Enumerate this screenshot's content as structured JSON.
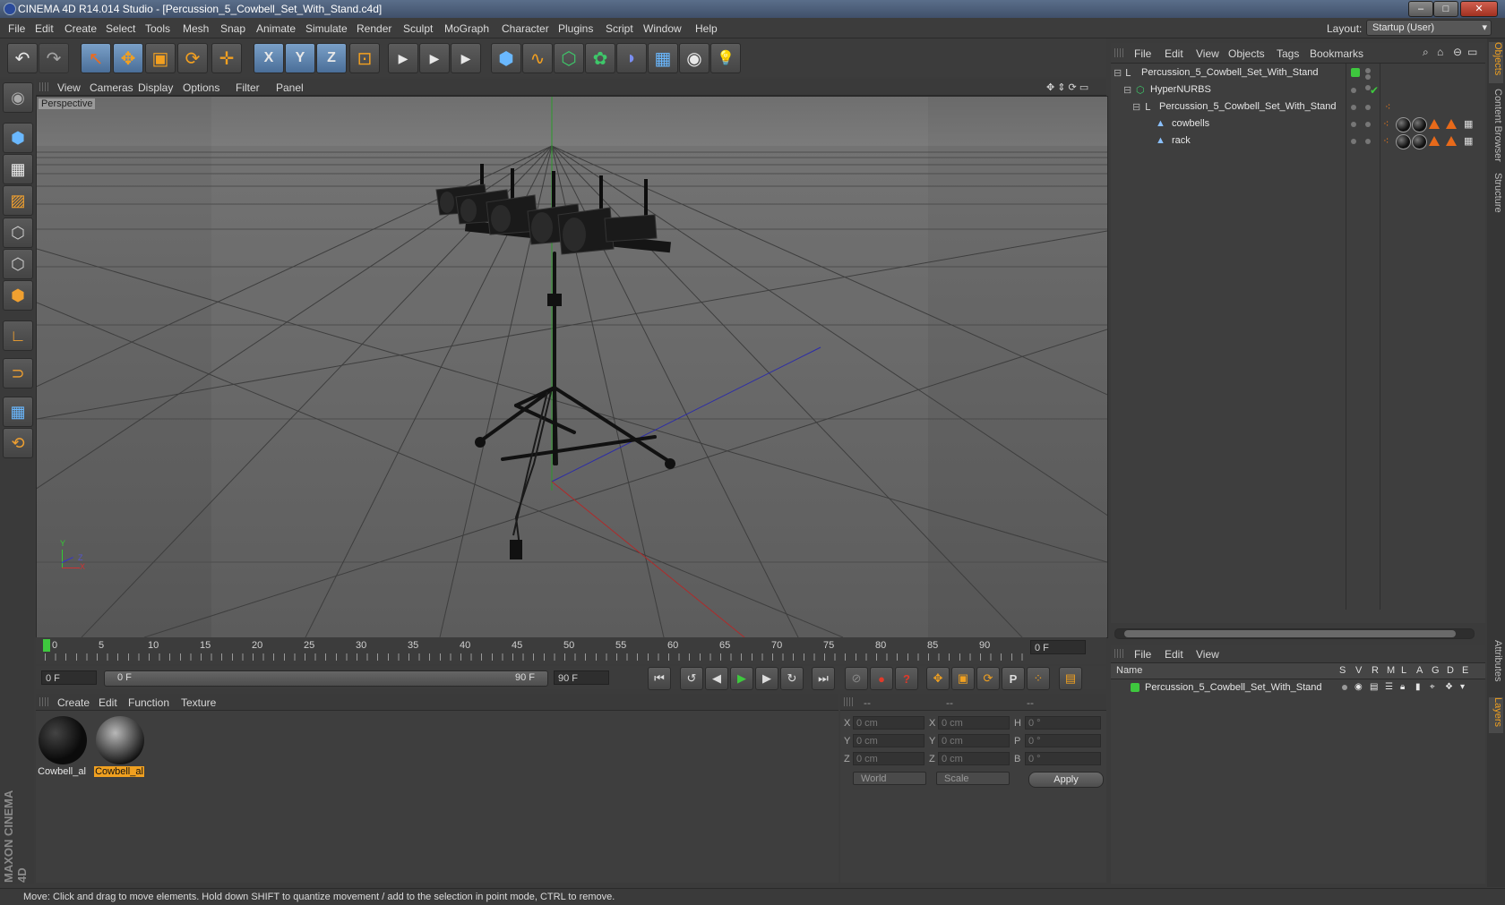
{
  "window": {
    "title": "CINEMA 4D R14.014 Studio - [Percussion_5_Cowbell_Set_With_Stand.c4d]",
    "minimize": "–",
    "maximize": "□",
    "close": "✕"
  },
  "menubar": {
    "items": [
      "File",
      "Edit",
      "Create",
      "Select",
      "Tools",
      "Mesh",
      "Snap",
      "Animate",
      "Simulate",
      "Render",
      "Sculpt",
      "MoGraph",
      "Character",
      "Plugins",
      "Script",
      "Window",
      "Help"
    ],
    "layout_label": "Layout:",
    "layout_value": "Startup (User)"
  },
  "toolbar": {
    "undo": "↶",
    "redo": "↷",
    "select": "↖",
    "move": "✥",
    "scale": "▣",
    "rotate": "⟳",
    "add": "✛",
    "x_axis": "X",
    "y_axis": "Y",
    "z_axis": "Z",
    "world": "⊡",
    "render_view": "▶",
    "render_pv": "▶",
    "render_settings": "▶",
    "cube": "⬢",
    "spline": "∿",
    "nurbs": "⬡",
    "array": "✿",
    "deformer": "◗",
    "floor": "▦",
    "camera": "◉",
    "light": "💡"
  },
  "viewport": {
    "menu": [
      "View",
      "Cameras",
      "Display",
      "Options",
      "Filter",
      "Panel"
    ],
    "label": "Perspective",
    "axis_y": "Y",
    "axis_x": "X",
    "axis_z": "Z"
  },
  "timeline": {
    "ticks": [
      "0",
      "5",
      "10",
      "15",
      "20",
      "25",
      "30",
      "35",
      "40",
      "45",
      "50",
      "55",
      "60",
      "65",
      "70",
      "75",
      "80",
      "85",
      "90"
    ],
    "current_frame": "0 F",
    "start_field": "0 F",
    "range_start": "0 F",
    "range_end": "90 F",
    "end_field": "90 F"
  },
  "playback": {
    "first": "⏮",
    "prev_key": "↺",
    "prev": "◀",
    "play": "▶",
    "next": "▶",
    "next_key": "↻",
    "last": "⏭",
    "record_off": "⊘",
    "record": "●",
    "help": "?",
    "pos": "✥",
    "scl": "▣",
    "rot": "⟳",
    "param": "P",
    "pla": "⁘",
    "film": "▤"
  },
  "materials": {
    "menu": [
      "Create",
      "Edit",
      "Function",
      "Texture"
    ],
    "items": [
      {
        "label": "Cowbell_al",
        "active": false
      },
      {
        "label": "Cowbell_al",
        "active": true
      }
    ]
  },
  "coordinates": {
    "headers": [
      "--",
      "--",
      "--"
    ],
    "rows": [
      {
        "a": "X",
        "av": "0 cm",
        "b": "X",
        "bv": "0 cm",
        "c": "H",
        "cv": "0 °"
      },
      {
        "a": "Y",
        "av": "0 cm",
        "b": "Y",
        "bv": "0 cm",
        "c": "P",
        "cv": "0 °"
      },
      {
        "a": "Z",
        "av": "0 cm",
        "b": "Z",
        "bv": "0 cm",
        "c": "B",
        "cv": "0 °"
      }
    ],
    "mode1": "World",
    "mode2": "Scale",
    "apply": "Apply"
  },
  "objects": {
    "menu": [
      "File",
      "Edit",
      "View",
      "Objects",
      "Tags",
      "Bookmarks"
    ],
    "tree": [
      {
        "name": "Percussion_5_Cowbell_Set_With_Stand",
        "indent": 0
      },
      {
        "name": "HyperNURBS",
        "indent": 1
      },
      {
        "name": "Percussion_5_Cowbell_Set_With_Stand",
        "indent": 2
      },
      {
        "name": "cowbells",
        "indent": 3
      },
      {
        "name": "rack",
        "indent": 3
      }
    ]
  },
  "layers": {
    "menu": [
      "File",
      "Edit",
      "View"
    ],
    "columns": [
      "Name",
      "S",
      "V",
      "R",
      "M",
      "L",
      "A",
      "G",
      "D",
      "E"
    ],
    "rows": [
      {
        "name": "Percussion_5_Cowbell_Set_With_Stand",
        "color": "#3cc83c"
      }
    ]
  },
  "side_tabs": [
    "Objects",
    "Content Browser",
    "Structure",
    "Attributes",
    "Layers"
  ],
  "status": "Move: Click and drag to move elements. Hold down SHIFT to quantize movement / add to the selection in point mode, CTRL to remove.",
  "brand": "MAXON CINEMA 4D"
}
